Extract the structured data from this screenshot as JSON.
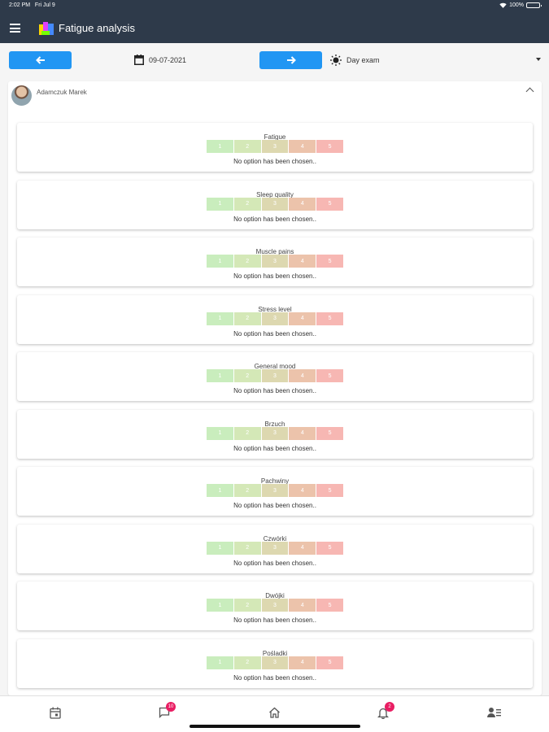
{
  "status_bar": {
    "time": "2:02 PM",
    "day": "Fri Jul 9",
    "battery": "100%"
  },
  "header": {
    "title": "Fatigue analysis"
  },
  "toolbar": {
    "date": "09-07-2021",
    "exam": "Day exam"
  },
  "user": {
    "name": "Adamczuk Marek"
  },
  "scale_colors": [
    "#c9edbd",
    "#d4e8b7",
    "#ddd8b0",
    "#ecc3ab",
    "#f7b7b3"
  ],
  "questions": [
    {
      "label": "Fatigue",
      "options": [
        "1",
        "2",
        "3",
        "4",
        "5"
      ],
      "message": "No option has been chosen.."
    },
    {
      "label": "Sleep quality",
      "options": [
        "1",
        "2",
        "3",
        "4",
        "5"
      ],
      "message": "No option has been chosen.."
    },
    {
      "label": "Muscle pains",
      "options": [
        "1",
        "2",
        "3",
        "4",
        "5"
      ],
      "message": "No option has been chosen.."
    },
    {
      "label": "Stress level",
      "options": [
        "1",
        "2",
        "3",
        "4",
        "5"
      ],
      "message": "No option has been chosen.."
    },
    {
      "label": "General mood",
      "options": [
        "1",
        "2",
        "3",
        "4",
        "5"
      ],
      "message": "No option has been chosen.."
    },
    {
      "label": "Brzuch",
      "options": [
        "1",
        "2",
        "3",
        "4",
        "5"
      ],
      "message": "No option has been chosen.."
    },
    {
      "label": "Pachwiny",
      "options": [
        "1",
        "2",
        "3",
        "4",
        "5"
      ],
      "message": "No option has been chosen.."
    },
    {
      "label": "Czwórki",
      "options": [
        "1",
        "2",
        "3",
        "4",
        "5"
      ],
      "message": "No option has been chosen.."
    },
    {
      "label": "Dwójki",
      "options": [
        "1",
        "2",
        "3",
        "4",
        "5"
      ],
      "message": "No option has been chosen.."
    },
    {
      "label": "Pośladki",
      "options": [
        "1",
        "2",
        "3",
        "4",
        "5"
      ],
      "message": "No option has been chosen.."
    }
  ],
  "bottom_nav": {
    "tabs": [
      {
        "icon": "calendar-icon"
      },
      {
        "icon": "chat-icon",
        "badge": "10"
      },
      {
        "icon": "home-icon"
      },
      {
        "icon": "bell-icon",
        "badge": "2"
      },
      {
        "icon": "profile-list-icon"
      }
    ]
  }
}
